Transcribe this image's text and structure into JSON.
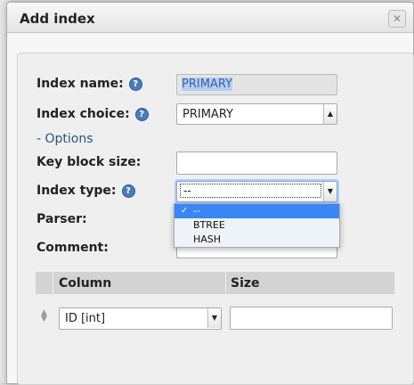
{
  "dialog": {
    "title": "Add index"
  },
  "fields": {
    "index_name_label": "Index name:",
    "index_name_value": "PRIMARY",
    "index_choice_label": "Index choice:",
    "index_choice_value": "PRIMARY",
    "options_link": "- Options",
    "key_block_label": "Key block size:",
    "key_block_value": "",
    "index_type_label": "Index type:",
    "index_type_value": "--",
    "parser_label": "Parser:",
    "comment_label": "Comment:"
  },
  "index_type_options": [
    "--",
    "BTREE",
    "HASH"
  ],
  "columns_table": {
    "headers": [
      "Column",
      "Size"
    ],
    "rows": [
      {
        "column": "ID [int]",
        "size": ""
      }
    ]
  },
  "icons": {
    "help": "help-icon",
    "close": "close-icon",
    "dropdown": "chevron-down-icon",
    "sort": "drag-handle-icon",
    "check": "checkmark-icon"
  }
}
